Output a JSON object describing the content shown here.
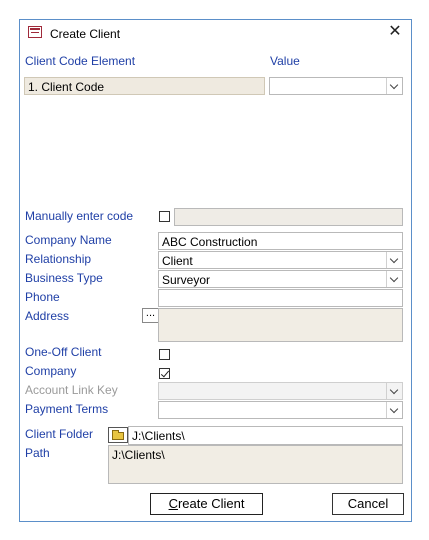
{
  "window": {
    "title": "Create Client",
    "close_glyph": "✕"
  },
  "headers": {
    "element": "Client Code Element",
    "value": "Value"
  },
  "code_row": {
    "element": "1. Client Code",
    "value": ""
  },
  "labels": {
    "manual": "Manually enter code",
    "company_name": "Company Name",
    "relationship": "Relationship",
    "business_type": "Business Type",
    "phone": "Phone",
    "address": "Address",
    "one_off": "One-Off Client",
    "company": "Company",
    "account_link": "Account Link Key",
    "payment_terms": "Payment Terms",
    "client_folder": "Client Folder",
    "path": "Path"
  },
  "fields": {
    "manual_checked": false,
    "manual_code": "",
    "company_name": "ABC Construction",
    "relationship": "Client",
    "business_type": "Surveyor",
    "phone": "",
    "address": "",
    "one_off_checked": false,
    "company_checked": true,
    "account_link": "",
    "payment_terms": "",
    "client_folder": "J:\\Clients\\",
    "path": "J:\\Clients\\"
  },
  "buttons": {
    "create_prefix": "C",
    "create_rest": "reate Client",
    "cancel": "Cancel",
    "address_browse": "..."
  },
  "icons": {
    "app": "form-icon",
    "folder": "folder-icon",
    "dropdown": "chevron-down-icon"
  },
  "colors": {
    "label": "#1f3fa6",
    "window_border": "#5b8fc9",
    "readonly_bg": "#f1ede4"
  }
}
